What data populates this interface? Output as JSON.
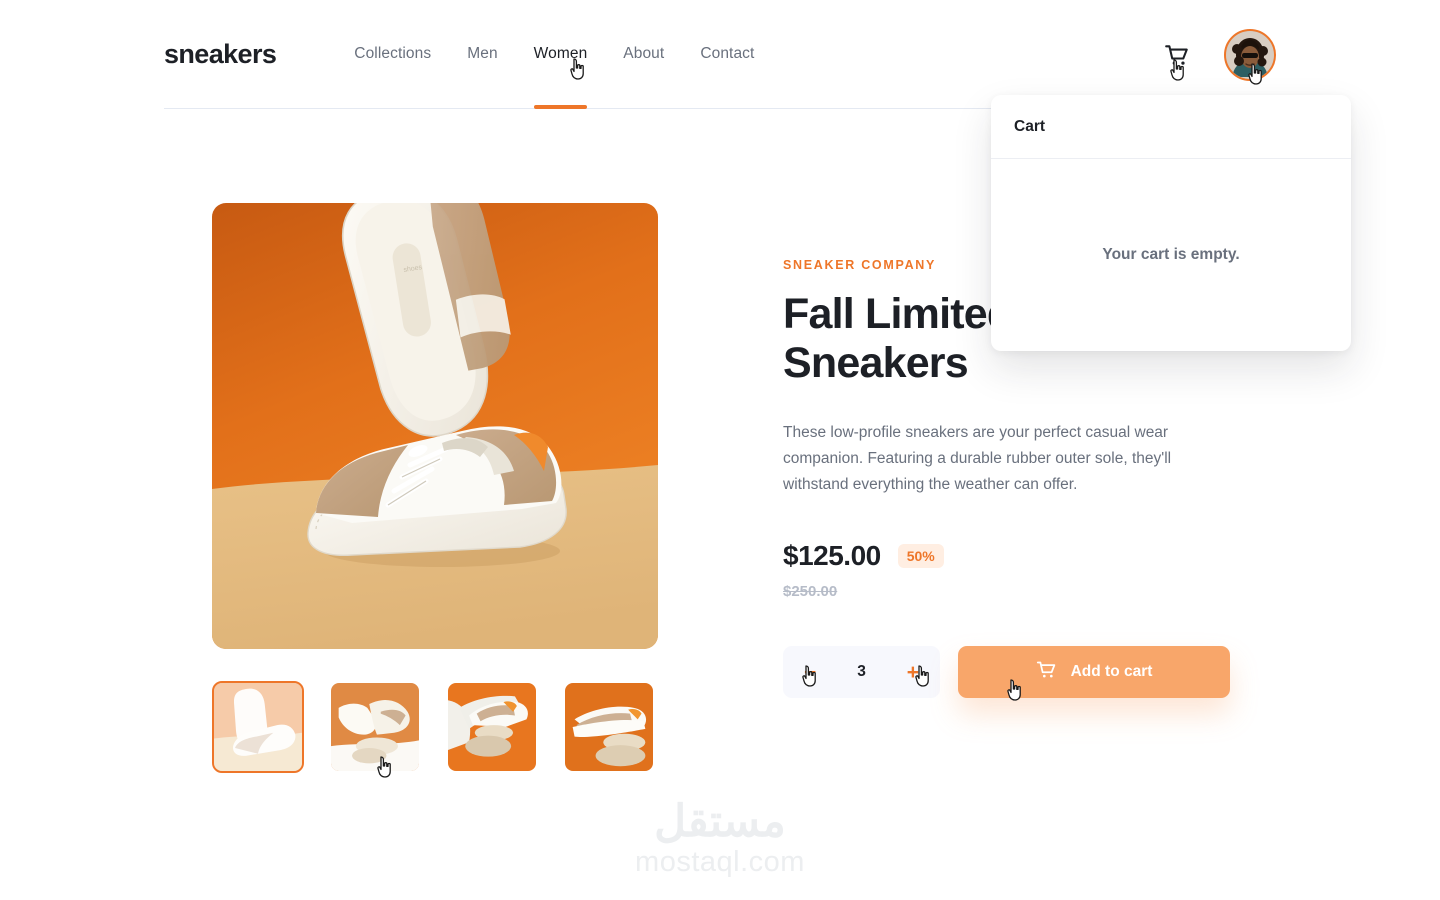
{
  "brandmark": "sneakers",
  "nav": {
    "items": [
      {
        "label": "Collections",
        "active": false
      },
      {
        "label": "Men",
        "active": false
      },
      {
        "label": "Women",
        "active": true
      },
      {
        "label": "About",
        "active": false
      },
      {
        "label": "Contact",
        "active": false
      }
    ]
  },
  "header": {
    "cart_icon": "shopping-cart-icon",
    "avatar_alt": "user-avatar"
  },
  "cart_panel": {
    "title": "Cart",
    "empty_message": "Your cart is empty."
  },
  "product": {
    "brand": "SNEAKER COMPANY",
    "title": "Fall Limited Edition Sneakers",
    "description": "These low-profile sneakers are your perfect casual wear companion. Featuring a durable rubber outer sole, they'll withstand everything the weather can offer.",
    "price": "$125.00",
    "discount": "50%",
    "old_price": "$250.00",
    "quantity": "3",
    "minus_label": "−",
    "plus_label": "+",
    "add_to_cart_label": "Add to cart"
  },
  "gallery": {
    "selected_index": 0,
    "thumbnails": [
      {
        "name": "thumbnail-1",
        "selected": true
      },
      {
        "name": "thumbnail-2",
        "selected": false
      },
      {
        "name": "thumbnail-3",
        "selected": false
      },
      {
        "name": "thumbnail-4",
        "selected": false
      }
    ]
  },
  "watermark": {
    "arabic": "مستقل",
    "latin": "mostaql.com"
  },
  "colors": {
    "accent": "#ee7629",
    "button": "#f8a66a",
    "badge_bg": "#ffeee2",
    "text": "#1d2026",
    "muted": "#69707d",
    "stepper_bg": "#f7f8fd"
  }
}
